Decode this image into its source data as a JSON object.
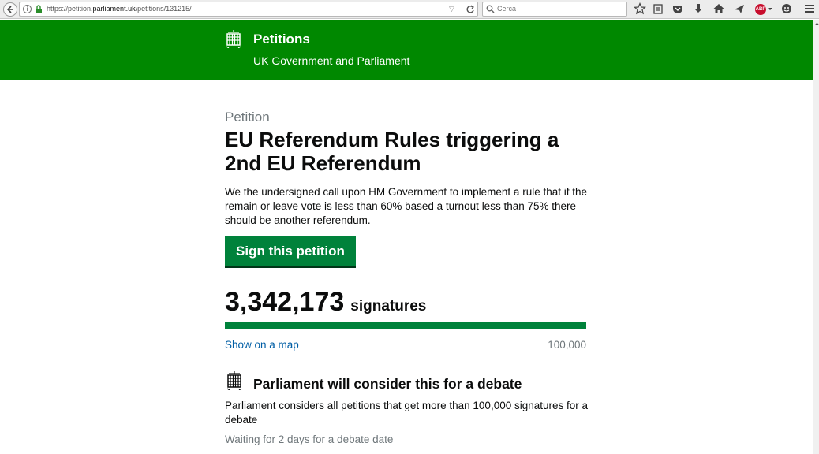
{
  "browser": {
    "url_prefix": "https://petition.",
    "url_domain": "parliament.uk",
    "url_path": "/petitions/131215/",
    "search_placeholder": "Cerca"
  },
  "header": {
    "title": "Petitions",
    "subtitle": "UK Government and Parliament",
    "icon": "portcullis-icon",
    "background": "#008800"
  },
  "petition": {
    "kicker": "Petition",
    "title": "EU Referendum Rules triggering a 2nd EU Referendum",
    "summary": "We the undersigned call upon HM Government to implement a rule that if the remain or leave vote is less than 60% based a turnout less than 75% there should be another referendum.",
    "sign_label": "Sign this petition",
    "signature_count": "3,342,173",
    "signature_label": "signatures",
    "progress_fraction": 1.0,
    "map_link": "Show on a map",
    "threshold": "100,000"
  },
  "debate": {
    "title": "Parliament will consider this for a debate",
    "text": "Parliament considers all petitions that get more than 100,000 signatures for a debate",
    "status": "Waiting for 2 days for a debate date"
  },
  "colors": {
    "brand_green": "#008800",
    "button_green": "#00823b",
    "link_blue": "#005ea5"
  }
}
